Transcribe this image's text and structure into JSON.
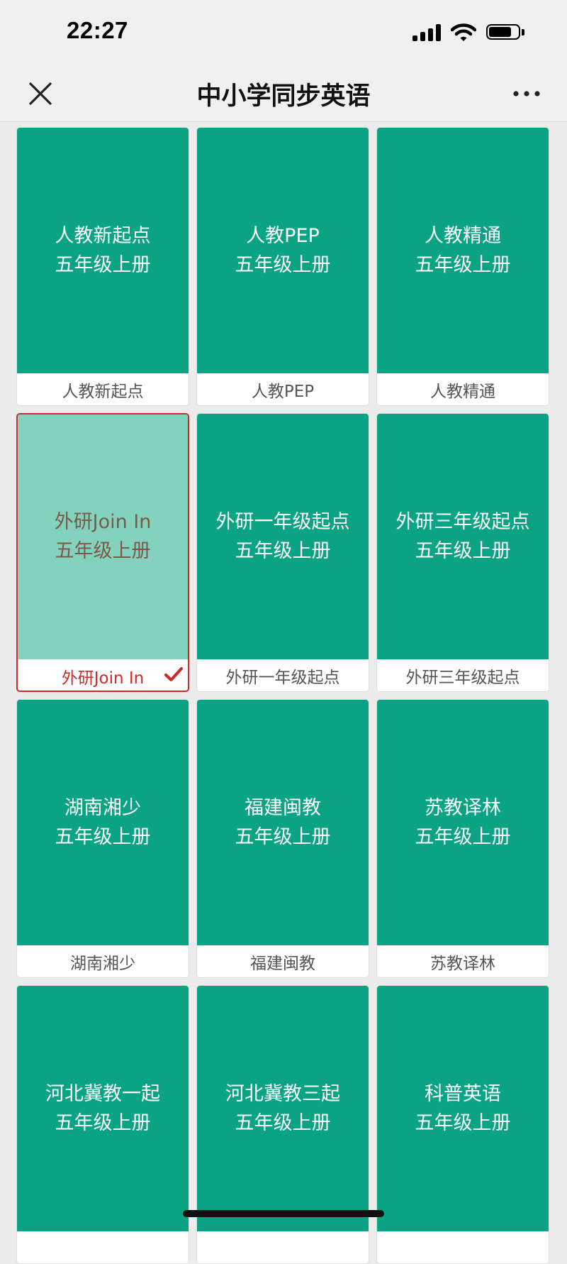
{
  "status_bar": {
    "time": "22:27",
    "battery_level": 0.78
  },
  "nav": {
    "title": "中小学同步英语",
    "close_icon": "close-icon",
    "more_icon": "more-icon"
  },
  "colors": {
    "card_cover": "#0aa485",
    "card_cover_selected": "#83d2bd",
    "selected_accent": "#cc2b2b",
    "nav_bg": "#f0f0f0"
  },
  "books": [
    {
      "cover_line1": "人教新起点",
      "cover_line2": "五年级上册",
      "caption": "人教新起点",
      "selected": false
    },
    {
      "cover_line1": "人教PEP",
      "cover_line2": "五年级上册",
      "caption": "人教PEP",
      "selected": false
    },
    {
      "cover_line1": "人教精通",
      "cover_line2": "五年级上册",
      "caption": "人教精通",
      "selected": false
    },
    {
      "cover_line1": "外研Join In",
      "cover_line2": "五年级上册",
      "caption": "外研Join In",
      "selected": true
    },
    {
      "cover_line1": "外研一年级起点",
      "cover_line2": "五年级上册",
      "caption": "外研一年级起点",
      "selected": false
    },
    {
      "cover_line1": "外研三年级起点",
      "cover_line2": "五年级上册",
      "caption": "外研三年级起点",
      "selected": false
    },
    {
      "cover_line1": "湖南湘少",
      "cover_line2": "五年级上册",
      "caption": "湖南湘少",
      "selected": false
    },
    {
      "cover_line1": "福建闽教",
      "cover_line2": "五年级上册",
      "caption": "福建闽教",
      "selected": false
    },
    {
      "cover_line1": "苏教译林",
      "cover_line2": "五年级上册",
      "caption": "苏教译林",
      "selected": false
    },
    {
      "cover_line1": "河北冀教一起",
      "cover_line2": "五年级上册",
      "caption": "",
      "selected": false
    },
    {
      "cover_line1": "河北冀教三起",
      "cover_line2": "五年级上册",
      "caption": "",
      "selected": false
    },
    {
      "cover_line1": "科普英语",
      "cover_line2": "五年级上册",
      "caption": "",
      "selected": false
    }
  ]
}
